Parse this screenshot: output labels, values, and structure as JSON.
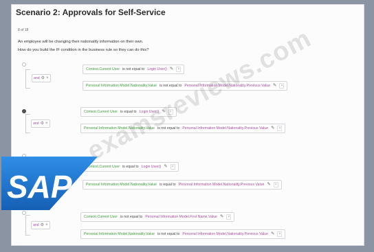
{
  "title": "Scenario 2: Approvals for Self-Service",
  "progress": "8 of 18",
  "question": {
    "line1": "An employee will be changing their nationality information on their own.",
    "line2": "How do you build the IF condition in the business rule so they can do this?"
  },
  "operator_label": "and",
  "options": [
    {
      "selected": false,
      "cond1": {
        "field": "Context.Current User",
        "op": "is not equal to",
        "value": "Login User()"
      },
      "cond2": {
        "field": "Personal Information Model.Nationality.Value",
        "op": "is not equal to",
        "value": "Personal Information Model.Nationality.Previous Value"
      }
    },
    {
      "selected": true,
      "cond1": {
        "field": "Context.Current User",
        "op": "is equal to",
        "value": "Login User()"
      },
      "cond2": {
        "field": "Personal Information Model.Nationality.Value",
        "op": "is not equal to",
        "value": "Personal Information Model.Nationality.Previous Value"
      }
    },
    {
      "selected": false,
      "cond1": {
        "field": "Context.Current User",
        "op": "is equal to",
        "value": "Login User()"
      },
      "cond2": {
        "field": "Personal Information Model.Nationality.Value",
        "op": "is equal to",
        "value": "Personal Information Model.Nationality.Previous Value"
      }
    },
    {
      "selected": false,
      "cond1": {
        "field": "Context.Current User",
        "op": "is not equal to",
        "value": "Personal Information Model.First Name.Value"
      },
      "cond2": {
        "field": "Personal Information Model.Nationality.Value",
        "op": "is not equal to",
        "value": "Personal Information Model.Nationality.Previous Value"
      }
    }
  ],
  "watermark": "examsreviews.com",
  "logo_text": "SAP",
  "colors": {
    "field": "#3c9a37",
    "value": "#a54b9a",
    "logo_blue": "#1a73c8"
  }
}
